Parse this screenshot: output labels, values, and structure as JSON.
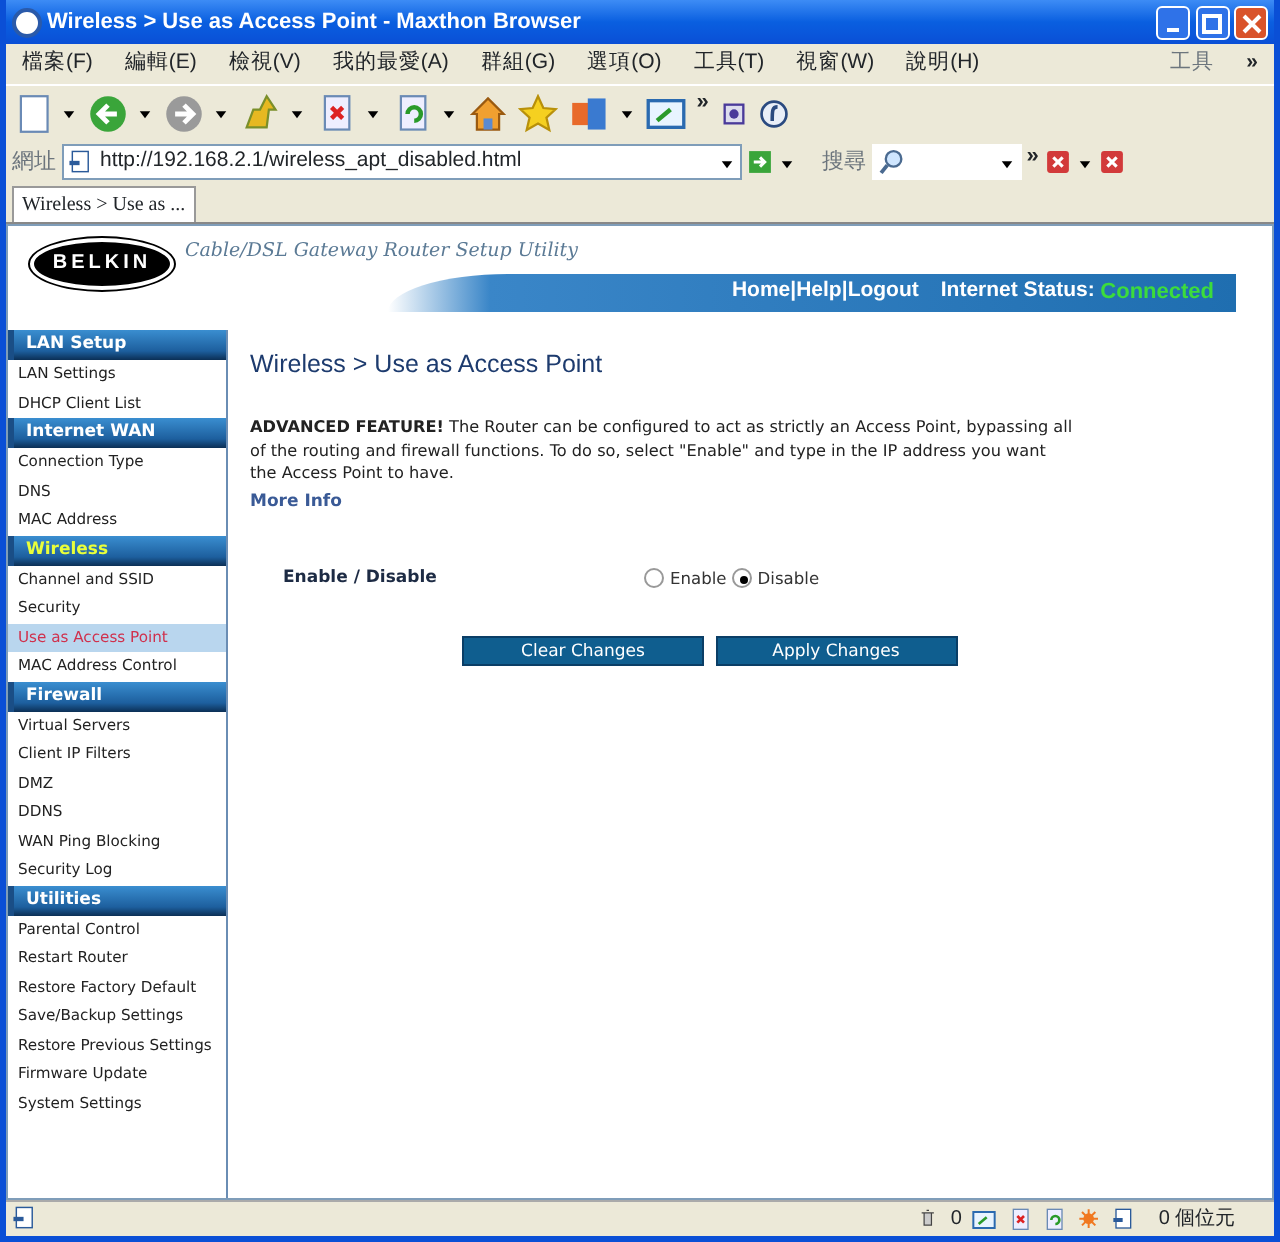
{
  "window": {
    "title": "Wireless > Use as Access Point - Maxthon Browser"
  },
  "menu": {
    "items": [
      "檔案(F)",
      "編輯(E)",
      "檢視(V)",
      "我的最愛(A)",
      "群組(G)",
      "選項(O)",
      "工具(T)",
      "視窗(W)",
      "說明(H)"
    ],
    "right_label": "工具",
    "more": "»"
  },
  "toolbar": {
    "more": "»"
  },
  "address_bar": {
    "label": "網址",
    "url": "http://192.168.2.1/wireless_apt_disabled.html",
    "search_label": "搜尋",
    "more": "»"
  },
  "tabs": [
    {
      "label": "Wireless > Use as ...",
      "selected": true
    }
  ],
  "header": {
    "logo": "BELKIN",
    "tagline": "Cable/DSL Gateway Router Setup Utility",
    "links": [
      "Home",
      "Help",
      "Logout"
    ],
    "separator": "|",
    "status_label": "Internet Status:",
    "status_value": "Connected"
  },
  "sidebar": [
    {
      "title": "LAN Setup",
      "selected": false,
      "items": [
        {
          "label": "LAN Settings",
          "selected": false
        },
        {
          "label": "DHCP Client List",
          "selected": false
        }
      ]
    },
    {
      "title": "Internet WAN",
      "selected": false,
      "items": [
        {
          "label": "Connection Type",
          "selected": false
        },
        {
          "label": "DNS",
          "selected": false
        },
        {
          "label": "MAC Address",
          "selected": false
        }
      ]
    },
    {
      "title": "Wireless",
      "selected": true,
      "items": [
        {
          "label": "Channel and SSID",
          "selected": false
        },
        {
          "label": "Security",
          "selected": false
        },
        {
          "label": "Use as Access Point",
          "selected": true
        },
        {
          "label": "MAC Address Control",
          "selected": false
        }
      ]
    },
    {
      "title": "Firewall",
      "selected": false,
      "items": [
        {
          "label": "Virtual Servers",
          "selected": false
        },
        {
          "label": "Client IP Filters",
          "selected": false
        },
        {
          "label": "DMZ",
          "selected": false
        },
        {
          "label": "DDNS",
          "selected": false
        },
        {
          "label": "WAN Ping Blocking",
          "selected": false
        },
        {
          "label": "Security Log",
          "selected": false
        }
      ]
    },
    {
      "title": "Utilities",
      "selected": false,
      "items": [
        {
          "label": "Parental Control",
          "selected": false
        },
        {
          "label": "Restart Router",
          "selected": false
        },
        {
          "label": "Restore Factory Default",
          "selected": false
        },
        {
          "label": "Save/Backup Settings",
          "selected": false
        },
        {
          "label": "Restore Previous Settings",
          "selected": false
        },
        {
          "label": "Firmware Update",
          "selected": false
        },
        {
          "label": "System Settings",
          "selected": false
        }
      ]
    }
  ],
  "page": {
    "title": "Wireless > Use as Access Point",
    "notice": "**ADVANCED FEATURE!** The Router can be configured to act as strictly an Access Point, bypassing all of the routing and firewall functions. To do so, select \"Enable\" and type in the IP address you want the Access Point to have.",
    "more_info": "More Info",
    "setting": {
      "label": "Enable / Disable",
      "options": [
        {
          "label": "Enable",
          "selected": false
        },
        {
          "label": "Disable",
          "selected": true
        }
      ]
    },
    "buttons": [
      "Clear Changes",
      "Apply Changes"
    ]
  },
  "status_bar": {
    "trash_count": "0",
    "bytes": "0 個位元"
  }
}
